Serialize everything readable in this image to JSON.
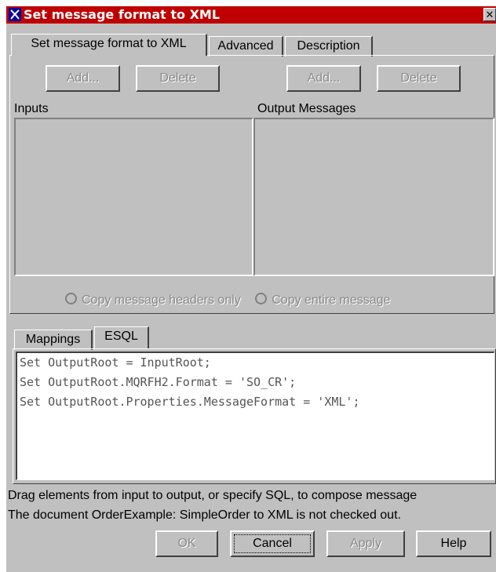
{
  "window": {
    "title": "Set message format to XML",
    "close_glyph": "✕"
  },
  "tabs": {
    "main": [
      "Set message format to XML",
      "Advanced",
      "Description"
    ],
    "sub": [
      "Mappings",
      "ESQL"
    ]
  },
  "inputs": {
    "label": "Inputs",
    "add_label": "Add...",
    "delete_label": "Delete"
  },
  "outputs": {
    "label": "Output Messages",
    "add_label": "Add...",
    "delete_label": "Delete"
  },
  "radio": {
    "headers_only": "Copy message headers only",
    "entire": "Copy entire message"
  },
  "esql": {
    "lines": [
      "Set OutputRoot = InputRoot;",
      "Set OutputRoot.MQRFH2.Format = 'SO_CR';",
      "Set OutputRoot.Properties.MessageFormat = 'XML';"
    ]
  },
  "status": {
    "hint": "Drag elements from input to output, or specify SQL, to compose message",
    "checkout": "The document OrderExample: SimpleOrder to XML is not checked out."
  },
  "buttons": {
    "ok": "OK",
    "cancel": "Cancel",
    "apply": "Apply",
    "help": "Help"
  },
  "colors": {
    "titlebar": "#c00000",
    "face": "#c0c0c0"
  },
  "icons": {
    "title": "app-icon",
    "close": "close-icon",
    "radio": "radio-icon"
  }
}
